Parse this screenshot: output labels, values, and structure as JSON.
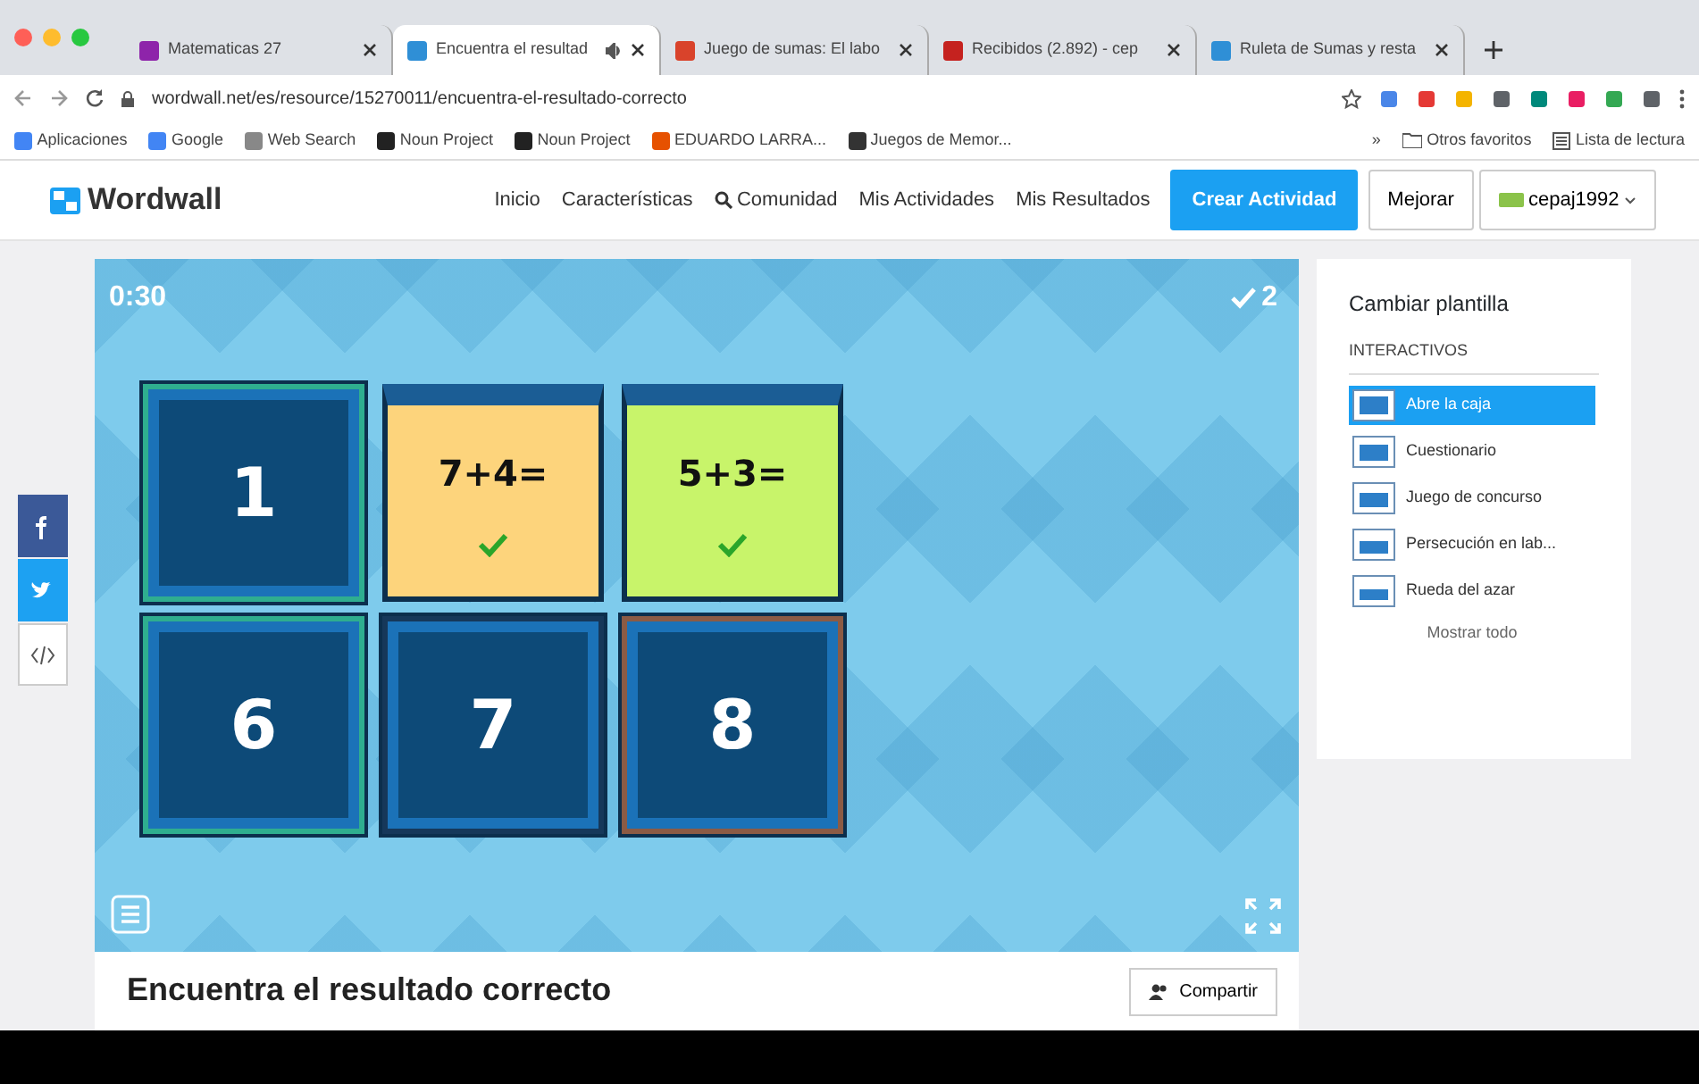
{
  "browser": {
    "tabs": [
      {
        "title": "Matematicas 27",
        "selected": false,
        "color": "#8e24aa"
      },
      {
        "title": "Encuentra el resultad",
        "selected": true,
        "color": "#2f8fd6"
      },
      {
        "title": "Juego de sumas: El labo",
        "selected": false,
        "color": "#d9432b"
      },
      {
        "title": "Recibidos (2.892) - cep",
        "selected": false,
        "color": "#c5221f"
      },
      {
        "title": "Ruleta de Sumas y resta",
        "selected": false,
        "color": "#2f8fd6"
      }
    ],
    "url": "wordwall.net/es/resource/15270011/encuentra-el-resultado-correcto",
    "bookmarks": [
      "Aplicaciones",
      "Google",
      "Web Search",
      "Noun Project",
      "Noun Project",
      "EDUARDO LARRA...",
      "Juegos de Memor..."
    ],
    "more_bookmarks": "»",
    "other_bookmarks": "Otros favoritos",
    "reading_list": "Lista de lectura"
  },
  "site": {
    "logo": "Wordwall",
    "nav": [
      "Inicio",
      "Características",
      "Comunidad",
      "Mis Actividades",
      "Mis Resultados"
    ],
    "create_button": "Crear Actividad",
    "upgrade_button": "Mejorar",
    "user": "cepaj1992"
  },
  "game": {
    "timer": "0:30",
    "score": "2",
    "tiles": [
      {
        "label": "1",
        "kind": "closed",
        "color": "#2fae8f"
      },
      {
        "label": "7+4=",
        "kind": "open",
        "color": "#fdd47c",
        "correct": true
      },
      {
        "label": "5+3=",
        "kind": "open",
        "color": "#c8f46a",
        "correct": true
      },
      {
        "label": "6",
        "kind": "closed",
        "color": "#2fae8f"
      },
      {
        "label": "7",
        "kind": "closed",
        "color": "#16385a"
      },
      {
        "label": "8",
        "kind": "closed",
        "color": "#8b5b45"
      }
    ]
  },
  "activity": {
    "title": "Encuentra el resultado correcto",
    "share_button": "Compartir"
  },
  "template_panel": {
    "title": "Cambiar plantilla",
    "section": "INTERACTIVOS",
    "templates": [
      {
        "name": "Abre la caja",
        "selected": true
      },
      {
        "name": "Cuestionario",
        "selected": false
      },
      {
        "name": "Juego de concurso",
        "selected": false
      },
      {
        "name": "Persecución en lab...",
        "selected": false
      },
      {
        "name": "Rueda del azar",
        "selected": false
      }
    ],
    "show_all": "Mostrar todo"
  }
}
